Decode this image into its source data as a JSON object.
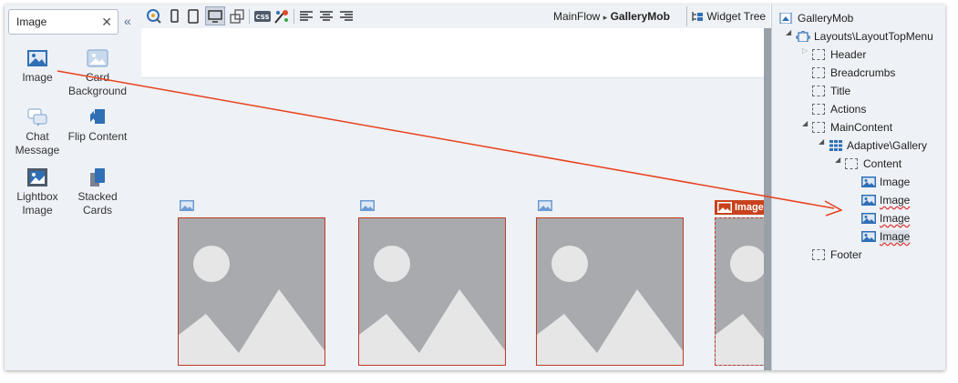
{
  "palette": {
    "search_value": "Image",
    "clear_icon": "close-icon",
    "collapse_icon": "double-chevron-left-icon",
    "widgets": [
      {
        "label": "Image",
        "icon": "image-icon"
      },
      {
        "label": "Card Background",
        "icon": "card-background-icon"
      },
      {
        "label": "Chat Message",
        "icon": "chat-icon"
      },
      {
        "label": "Flip Content",
        "icon": "flip-icon"
      },
      {
        "label": "Lightbox Image",
        "icon": "lightbox-icon"
      },
      {
        "label": "Stacked Cards",
        "icon": "stacked-cards-icon"
      }
    ]
  },
  "toolbar": {
    "icons": [
      "preview-icon",
      "phone-icon",
      "tablet-icon",
      "desktop-icon",
      "screen-rotate-icon",
      "css-icon",
      "theme-palette-icon",
      "align-left-icon",
      "align-center-icon",
      "align-right-icon"
    ],
    "breadcrumb_flow": "MainFlow",
    "breadcrumb_separator": "▸",
    "breadcrumb_screen": "GalleryMob",
    "widget_tree_tab": "Widget Tree"
  },
  "canvas": {
    "selected_badge": "Image",
    "card_count": 4
  },
  "tree": {
    "root": "GalleryMob",
    "layout": "Layouts\\LayoutTopMenu",
    "header": "Header",
    "breadcrumbs": "Breadcrumbs",
    "title": "Title",
    "actions": "Actions",
    "main_content": "MainContent",
    "gallery": "Adaptive\\Gallery",
    "content": "Content",
    "images": [
      "Image",
      "Image",
      "Image",
      "Image"
    ],
    "footer": "Footer"
  },
  "colors": {
    "accent_red": "#c8421d",
    "card_border": "#c0392b",
    "panel_bg": "#eef1f6",
    "image_placeholder": "#a9aaad",
    "icon_blue": "#2f6fb5"
  }
}
